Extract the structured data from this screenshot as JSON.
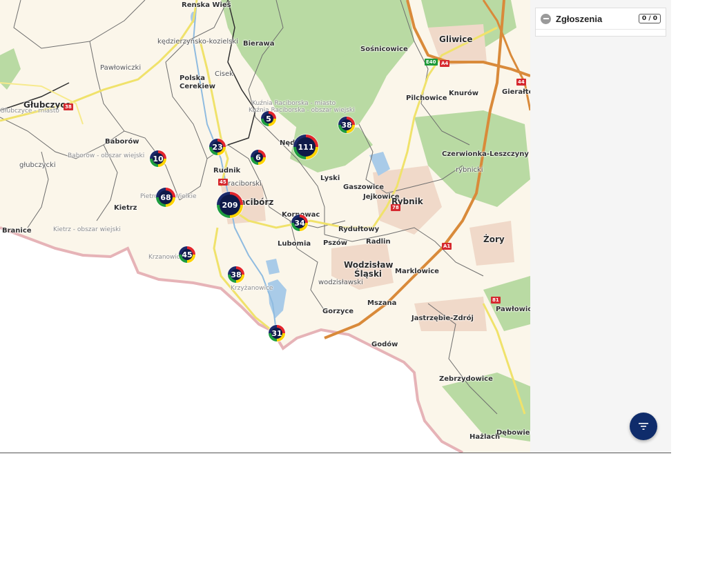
{
  "panel": {
    "title": "Zgłoszenia",
    "count": "0 / 0",
    "collapse_icon": "minus-circle-icon"
  },
  "filter_button": {
    "icon": "filter-icon"
  },
  "colors": {
    "cluster_red": "#e3262d",
    "cluster_yellow": "#ffd400",
    "cluster_green": "#1e9d3f",
    "cluster_navy": "#0f1a49",
    "fab": "#0f2c6b",
    "forest": "#b7d9a3",
    "water": "#a9cbe8",
    "border": "#d9a3a8"
  },
  "clusters": [
    "5",
    "38",
    "23",
    "6",
    "111",
    "10",
    "68",
    "209",
    "34",
    "45",
    "38",
    "31"
  ],
  "places": [
    "Renska Wieś",
    "kędzierzyńsko-kozielski",
    "Bierawa",
    "Sośnicowice",
    "Gliwice",
    "Pawłowiczki",
    "Polska Cerekiew",
    "Cisek",
    "Głubczyce",
    "Głubczyce - miasto",
    "Baborów",
    "Baborów - obszar wiejski",
    "Kuźnia Raciborska - miasto",
    "Kuźnia Raciborska - obszar wiejski",
    "Pilchowice",
    "Knurów",
    "Gierałtowice",
    "głubczycki",
    "Rudnik",
    "Nędza",
    "raciborski",
    "Lyski",
    "Gaszowice",
    "Jejkowice",
    "Rybnik",
    "Czerwionka-Leszczyny",
    "rybnicki",
    "Kietrz",
    "Kietrz - obszar wiejski",
    "Branice",
    "Racibórz",
    "Kornowac",
    "Rydułtowy",
    "Radlin",
    "Lubomia",
    "Pszów",
    "Żory",
    "Krzanowice",
    "Wodzisław Śląski",
    "wodzisławski",
    "Marklowice",
    "Krzyżanowice",
    "Mszana",
    "Gorzyce",
    "Jastrzębie-Zdrój",
    "Godów",
    "Pawłowice",
    "Zebrzydowice",
    "Hażlach",
    "Dębowiec",
    "Pietrowice Wielkie"
  ],
  "roads": [
    "38",
    "45",
    "78",
    "A1",
    "81",
    "E40",
    "A4",
    "44"
  ]
}
